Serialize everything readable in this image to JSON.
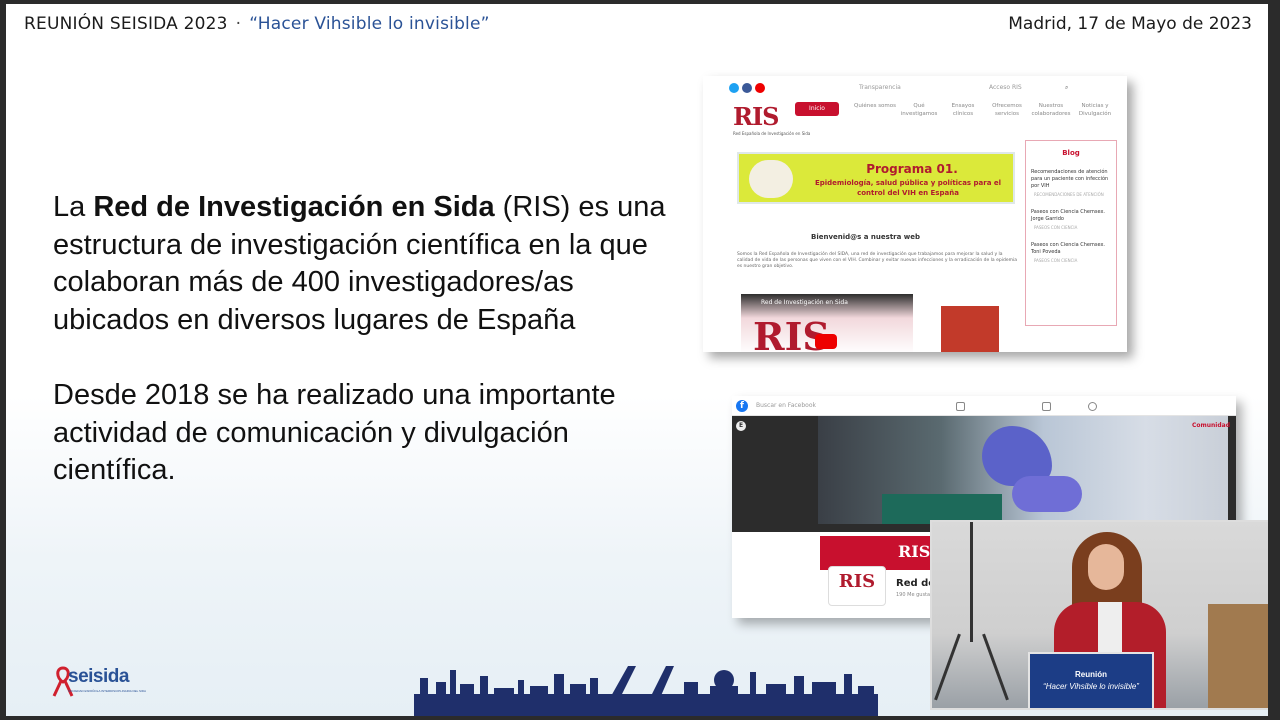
{
  "header": {
    "event": "REUNIÓN SEISIDA 2023",
    "separator": "·",
    "motto": "“Hacer Vihsible lo invisible”",
    "date_place": "Madrid, 17 de Mayo de 2023"
  },
  "body": {
    "p1_pre": "La ",
    "p1_bold": "Red de Investigación en Sida",
    "p1_post": " (RIS) es una estructura de investigación científica en la que colaboran más de 400 investigadores/as ubicados en diversos lugares de España",
    "p2": "Desde 2018 se ha realizado una importante actividad de comunicación y divulgación científica."
  },
  "ris_site": {
    "top_links": [
      "Transparencia",
      "Acceso RIS"
    ],
    "logo": "RIS",
    "logo_sub": "Red Española de Investigación en Sida",
    "nav": [
      "Inicio",
      "Quiénes somos",
      "Qué investigamos",
      "Ensayos clínicos",
      "Ofrecemos servicios",
      "Nuestros colaboradores",
      "Noticias y Divulgación"
    ],
    "banner_title": "Programa 01.",
    "banner_sub": "Epidemiología, salud pública y políticas para el control del VIH en España",
    "welcome": "Bienvenid@s a nuestra web",
    "welcome_text": "Somos la Red Española de Investigación del SIDA, una red de investigación que trabajamos para mejorar la salud y la calidad de vida de las personas que viven con el VIH. Combinar y evitar nuevas infecciones y la erradicación de la epidemia es nuestro gran objetivo.",
    "video_title": "Red de Investigación en Sida",
    "blog_title": "Blog",
    "blog_items": [
      {
        "title": "Recomendaciones de atención para un paciente con infección por VIH",
        "meta": "RECOMENDACIONES DE ATENCIÓN"
      },
      {
        "title": "Paseos con Ciencia Chemsex. Jorge Garrido",
        "meta": "PASEOS CON CIENCIA"
      },
      {
        "title": "Paseos con Ciencia Chemsex. Toni Poveda",
        "meta": "PASEOS CON CIENCIA"
      }
    ]
  },
  "facebook": {
    "search_placeholder": "Buscar en Facebook",
    "badge": "E",
    "corner_label": "Comunidad",
    "cover_logo": "RIS",
    "profile_logo": "RIS",
    "page_name": "Red de",
    "likes": "190 Me gusta"
  },
  "webcam": {
    "podium_line1": "Reunión",
    "podium_line2": "“Hacer Vihsible lo invisible”"
  },
  "footer": {
    "logo_sei": "sei",
    "logo_sida": "sida",
    "logo_tagline": "SOCIEDAD ESPAÑOLA INTERDISCIPLINARIA DEL SIDA"
  },
  "colors": {
    "accent_blue": "#2a5296",
    "ris_red": "#c8102e",
    "banner_green": "#dbe93a",
    "podium_blue": "#1c3d86"
  }
}
